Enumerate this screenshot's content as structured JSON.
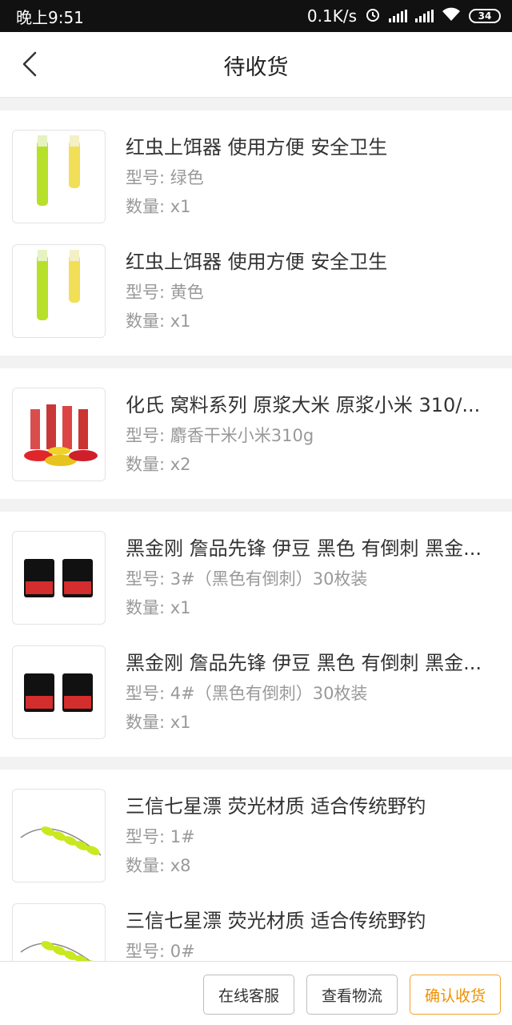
{
  "status_bar": {
    "time": "晚上9:51",
    "speed": "0.1K/s",
    "battery": "34"
  },
  "header": {
    "title": "待收货"
  },
  "groups": [
    {
      "items": [
        {
          "name": "红虫上饵器 使用方便 安全卫生",
          "spec": "型号: 绿色",
          "qty": "数量: x1",
          "image": "bait-tool"
        },
        {
          "name": "红虫上饵器 使用方便 安全卫生",
          "spec": "型号: 黄色",
          "qty": "数量: x1",
          "image": "bait-tool"
        }
      ]
    },
    {
      "items": [
        {
          "name": "化氏 窝料系列 原浆大米 原浆小米 310/...",
          "spec": "型号: 麝香干米小米310g",
          "qty": "数量: x2",
          "image": "bait-bottles"
        }
      ]
    },
    {
      "items": [
        {
          "name": "黑金刚 詹品先锋 伊豆 黑色 有倒刺 黑金...",
          "spec": "型号: 3#（黑色有倒刺）30枚装",
          "qty": "数量: x1",
          "image": "hook-pack"
        },
        {
          "name": "黑金刚 詹品先锋 伊豆 黑色 有倒刺 黑金...",
          "spec": "型号: 4#（黑色有倒刺）30枚装",
          "qty": "数量: x1",
          "image": "hook-pack"
        }
      ]
    },
    {
      "items": [
        {
          "name": "三信七星漂 荧光材质 适合传统野钓",
          "spec": "型号: 1#",
          "qty": "数量: x8",
          "image": "float-string"
        },
        {
          "name": "三信七星漂 荧光材质 适合传统野钓",
          "spec": "型号: 0#",
          "qty": "",
          "image": "float-string"
        }
      ]
    }
  ],
  "actions": {
    "customer_service": "在线客服",
    "logistics": "查看物流",
    "confirm": "确认收货"
  },
  "colors": {
    "accent": "#ef8f00",
    "background": "#f2f2f2"
  }
}
